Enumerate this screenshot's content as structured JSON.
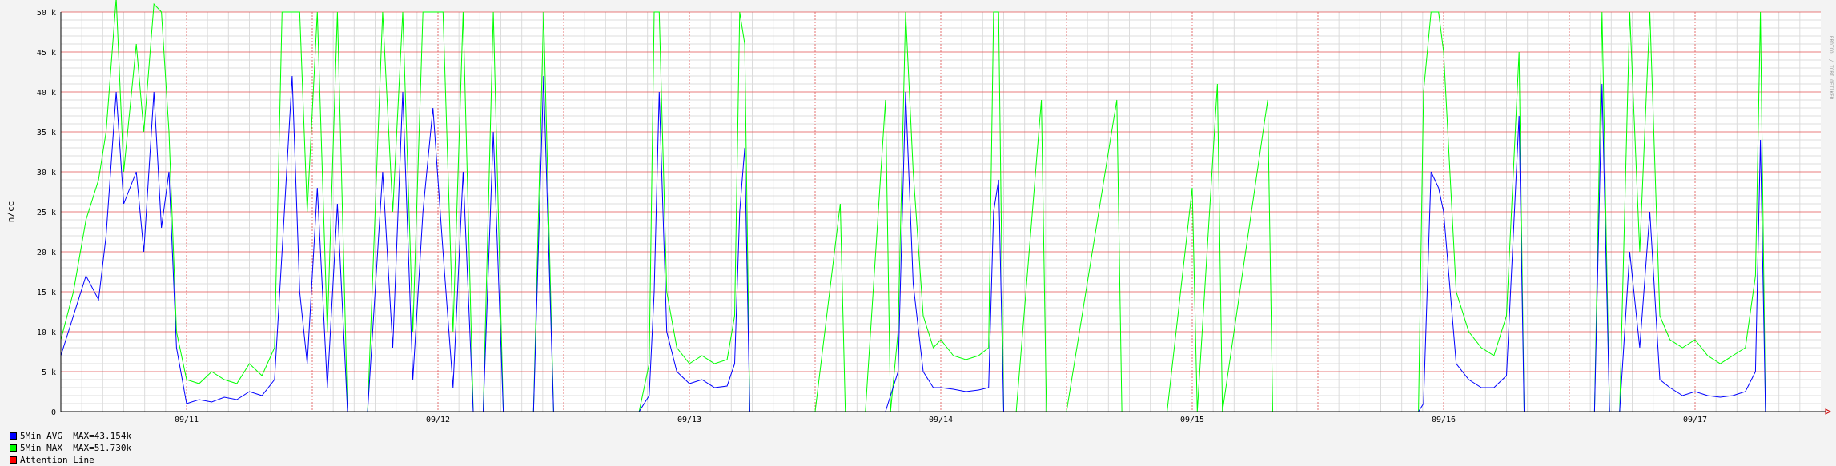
{
  "chart_data": {
    "type": "line",
    "ylabel": "n/cc",
    "watermark": "RRDTOOL / TOBI OETIKER",
    "ylim": [
      0,
      50000
    ],
    "yticks": [
      {
        "value": 0,
        "label": "0"
      },
      {
        "value": 5000,
        "label": "5 k"
      },
      {
        "value": 10000,
        "label": "10 k"
      },
      {
        "value": 15000,
        "label": "15 k"
      },
      {
        "value": 20000,
        "label": "20 k"
      },
      {
        "value": 25000,
        "label": "25 k"
      },
      {
        "value": 30000,
        "label": "30 k"
      },
      {
        "value": 35000,
        "label": "35 k"
      },
      {
        "value": 40000,
        "label": "40 k"
      },
      {
        "value": 45000,
        "label": "45 k"
      },
      {
        "value": 50000,
        "label": "50 k"
      }
    ],
    "xlim_days": [
      0,
      7
    ],
    "xticks": [
      {
        "day": 0.5,
        "label": "09/11"
      },
      {
        "day": 1.5,
        "label": "09/12"
      },
      {
        "day": 2.5,
        "label": "09/13"
      },
      {
        "day": 3.5,
        "label": "09/14"
      },
      {
        "day": 4.5,
        "label": "09/15"
      },
      {
        "day": 5.5,
        "label": "09/16"
      },
      {
        "day": 6.5,
        "label": "09/17"
      }
    ],
    "legend": [
      {
        "color": "#0000ff",
        "label": "5Min AVG  MAX=43.154k"
      },
      {
        "color": "#00ff00",
        "label": "5Min MAX  MAX=51.730k"
      },
      {
        "color": "#ff0000",
        "label": "Attention Line"
      }
    ],
    "series": [
      {
        "name": "5Min AVG",
        "color": "#0000ff",
        "points": [
          [
            0.0,
            7000
          ],
          [
            0.05,
            12000
          ],
          [
            0.1,
            17000
          ],
          [
            0.15,
            14000
          ],
          [
            0.18,
            22000
          ],
          [
            0.22,
            40000
          ],
          [
            0.25,
            26000
          ],
          [
            0.3,
            30000
          ],
          [
            0.33,
            20000
          ],
          [
            0.37,
            40000
          ],
          [
            0.4,
            23000
          ],
          [
            0.43,
            30000
          ],
          [
            0.46,
            8000
          ],
          [
            0.5,
            1000
          ],
          [
            0.55,
            1500
          ],
          [
            0.6,
            1200
          ],
          [
            0.65,
            1800
          ],
          [
            0.7,
            1500
          ],
          [
            0.75,
            2500
          ],
          [
            0.8,
            2000
          ],
          [
            0.85,
            4000
          ],
          [
            0.88,
            20000
          ],
          [
            0.92,
            42000
          ],
          [
            0.95,
            15000
          ],
          [
            0.98,
            6000
          ],
          [
            1.02,
            28000
          ],
          [
            1.06,
            3000
          ],
          [
            1.1,
            26000
          ],
          [
            1.14,
            0
          ],
          [
            1.18,
            0
          ],
          [
            1.22,
            0
          ],
          [
            1.28,
            30000
          ],
          [
            1.32,
            8000
          ],
          [
            1.36,
            40000
          ],
          [
            1.4,
            4000
          ],
          [
            1.44,
            25000
          ],
          [
            1.48,
            38000
          ],
          [
            1.52,
            20000
          ],
          [
            1.56,
            3000
          ],
          [
            1.6,
            30000
          ],
          [
            1.64,
            0
          ],
          [
            1.68,
            0
          ],
          [
            1.72,
            35000
          ],
          [
            1.76,
            0
          ],
          [
            1.8,
            0
          ],
          [
            1.84,
            0
          ],
          [
            1.88,
            0
          ],
          [
            1.92,
            42000
          ],
          [
            1.96,
            0
          ],
          [
            2.0,
            0
          ],
          [
            2.1,
            0
          ],
          [
            2.2,
            0
          ],
          [
            2.3,
            0
          ],
          [
            2.34,
            2000
          ],
          [
            2.36,
            15000
          ],
          [
            2.38,
            40000
          ],
          [
            2.41,
            10000
          ],
          [
            2.45,
            5000
          ],
          [
            2.5,
            3500
          ],
          [
            2.55,
            4000
          ],
          [
            2.6,
            3000
          ],
          [
            2.65,
            3200
          ],
          [
            2.68,
            6000
          ],
          [
            2.7,
            25000
          ],
          [
            2.72,
            33000
          ],
          [
            2.74,
            0
          ],
          [
            2.8,
            0
          ],
          [
            2.9,
            0
          ],
          [
            3.0,
            0
          ],
          [
            3.1,
            0
          ],
          [
            3.2,
            0
          ],
          [
            3.28,
            0
          ],
          [
            3.33,
            5000
          ],
          [
            3.36,
            40000
          ],
          [
            3.39,
            16000
          ],
          [
            3.43,
            5000
          ],
          [
            3.47,
            3000
          ],
          [
            3.5,
            3000
          ],
          [
            3.55,
            2800
          ],
          [
            3.6,
            2500
          ],
          [
            3.65,
            2700
          ],
          [
            3.69,
            3000
          ],
          [
            3.71,
            25000
          ],
          [
            3.73,
            29000
          ],
          [
            3.75,
            0
          ],
          [
            3.8,
            0
          ],
          [
            4.0,
            0
          ],
          [
            4.2,
            0
          ],
          [
            4.4,
            0
          ],
          [
            4.6,
            0
          ],
          [
            4.8,
            0
          ],
          [
            5.0,
            0
          ],
          [
            5.2,
            0
          ],
          [
            5.4,
            0
          ],
          [
            5.42,
            1000
          ],
          [
            5.45,
            30000
          ],
          [
            5.48,
            28000
          ],
          [
            5.5,
            25000
          ],
          [
            5.55,
            6000
          ],
          [
            5.6,
            4000
          ],
          [
            5.65,
            3000
          ],
          [
            5.7,
            3000
          ],
          [
            5.75,
            4500
          ],
          [
            5.8,
            37000
          ],
          [
            5.82,
            0
          ],
          [
            5.9,
            0
          ],
          [
            6.0,
            0
          ],
          [
            6.1,
            0
          ],
          [
            6.13,
            41000
          ],
          [
            6.16,
            0
          ],
          [
            6.2,
            0
          ],
          [
            6.24,
            20000
          ],
          [
            6.28,
            8000
          ],
          [
            6.32,
            25000
          ],
          [
            6.36,
            4000
          ],
          [
            6.4,
            3000
          ],
          [
            6.45,
            2000
          ],
          [
            6.5,
            2500
          ],
          [
            6.55,
            2000
          ],
          [
            6.6,
            1800
          ],
          [
            6.65,
            2000
          ],
          [
            6.7,
            2500
          ],
          [
            6.74,
            5000
          ],
          [
            6.76,
            34000
          ],
          [
            6.78,
            0
          ]
        ]
      },
      {
        "name": "5Min MAX",
        "color": "#00ff00",
        "points": [
          [
            0.0,
            9000
          ],
          [
            0.05,
            15000
          ],
          [
            0.1,
            24000
          ],
          [
            0.15,
            29000
          ],
          [
            0.18,
            35000
          ],
          [
            0.22,
            51730
          ],
          [
            0.25,
            30000
          ],
          [
            0.3,
            46000
          ],
          [
            0.33,
            35000
          ],
          [
            0.37,
            51000
          ],
          [
            0.4,
            50000
          ],
          [
            0.43,
            35000
          ],
          [
            0.46,
            10000
          ],
          [
            0.5,
            4000
          ],
          [
            0.55,
            3500
          ],
          [
            0.6,
            5000
          ],
          [
            0.65,
            4000
          ],
          [
            0.7,
            3500
          ],
          [
            0.75,
            6000
          ],
          [
            0.8,
            4500
          ],
          [
            0.85,
            8000
          ],
          [
            0.88,
            50000
          ],
          [
            0.92,
            50000
          ],
          [
            0.95,
            50000
          ],
          [
            0.98,
            25000
          ],
          [
            1.02,
            50000
          ],
          [
            1.06,
            10000
          ],
          [
            1.1,
            50000
          ],
          [
            1.14,
            0
          ],
          [
            1.18,
            0
          ],
          [
            1.22,
            0
          ],
          [
            1.28,
            50000
          ],
          [
            1.32,
            25000
          ],
          [
            1.36,
            50000
          ],
          [
            1.4,
            10000
          ],
          [
            1.44,
            50000
          ],
          [
            1.48,
            50000
          ],
          [
            1.52,
            50000
          ],
          [
            1.56,
            10000
          ],
          [
            1.6,
            50000
          ],
          [
            1.64,
            0
          ],
          [
            1.68,
            0
          ],
          [
            1.72,
            50000
          ],
          [
            1.76,
            0
          ],
          [
            1.8,
            0
          ],
          [
            1.84,
            0
          ],
          [
            1.88,
            0
          ],
          [
            1.92,
            50000
          ],
          [
            1.96,
            0
          ],
          [
            2.0,
            0
          ],
          [
            2.1,
            0
          ],
          [
            2.2,
            0
          ],
          [
            2.3,
            0
          ],
          [
            2.34,
            6000
          ],
          [
            2.36,
            50000
          ],
          [
            2.38,
            50000
          ],
          [
            2.41,
            15000
          ],
          [
            2.45,
            8000
          ],
          [
            2.5,
            6000
          ],
          [
            2.55,
            7000
          ],
          [
            2.6,
            6000
          ],
          [
            2.65,
            6500
          ],
          [
            2.68,
            12000
          ],
          [
            2.7,
            50000
          ],
          [
            2.72,
            46000
          ],
          [
            2.74,
            0
          ],
          [
            2.8,
            0
          ],
          [
            2.9,
            0
          ],
          [
            3.0,
            0
          ],
          [
            3.1,
            26000
          ],
          [
            3.12,
            0
          ],
          [
            3.2,
            0
          ],
          [
            3.28,
            39000
          ],
          [
            3.3,
            0
          ],
          [
            3.33,
            10000
          ],
          [
            3.36,
            50000
          ],
          [
            3.39,
            30000
          ],
          [
            3.43,
            12000
          ],
          [
            3.47,
            8000
          ],
          [
            3.5,
            9000
          ],
          [
            3.55,
            7000
          ],
          [
            3.6,
            6500
          ],
          [
            3.65,
            7000
          ],
          [
            3.69,
            8000
          ],
          [
            3.71,
            50000
          ],
          [
            3.73,
            50000
          ],
          [
            3.75,
            0
          ],
          [
            3.8,
            0
          ],
          [
            3.9,
            39000
          ],
          [
            3.92,
            0
          ],
          [
            4.0,
            0
          ],
          [
            4.2,
            39000
          ],
          [
            4.22,
            0
          ],
          [
            4.4,
            0
          ],
          [
            4.5,
            28000
          ],
          [
            4.52,
            0
          ],
          [
            4.6,
            41000
          ],
          [
            4.62,
            0
          ],
          [
            4.8,
            39000
          ],
          [
            4.82,
            0
          ],
          [
            5.0,
            0
          ],
          [
            5.2,
            0
          ],
          [
            5.4,
            0
          ],
          [
            5.42,
            40000
          ],
          [
            5.45,
            50000
          ],
          [
            5.48,
            50000
          ],
          [
            5.5,
            45000
          ],
          [
            5.55,
            15000
          ],
          [
            5.6,
            10000
          ],
          [
            5.65,
            8000
          ],
          [
            5.7,
            7000
          ],
          [
            5.75,
            12000
          ],
          [
            5.8,
            45000
          ],
          [
            5.82,
            0
          ],
          [
            5.9,
            0
          ],
          [
            6.0,
            0
          ],
          [
            6.1,
            0
          ],
          [
            6.13,
            50000
          ],
          [
            6.16,
            0
          ],
          [
            6.2,
            0
          ],
          [
            6.24,
            50000
          ],
          [
            6.28,
            20000
          ],
          [
            6.32,
            50000
          ],
          [
            6.36,
            12000
          ],
          [
            6.4,
            9000
          ],
          [
            6.45,
            8000
          ],
          [
            6.5,
            9000
          ],
          [
            6.55,
            7000
          ],
          [
            6.6,
            6000
          ],
          [
            6.65,
            7000
          ],
          [
            6.7,
            8000
          ],
          [
            6.74,
            17000
          ],
          [
            6.76,
            50000
          ],
          [
            6.78,
            0
          ]
        ]
      }
    ]
  }
}
